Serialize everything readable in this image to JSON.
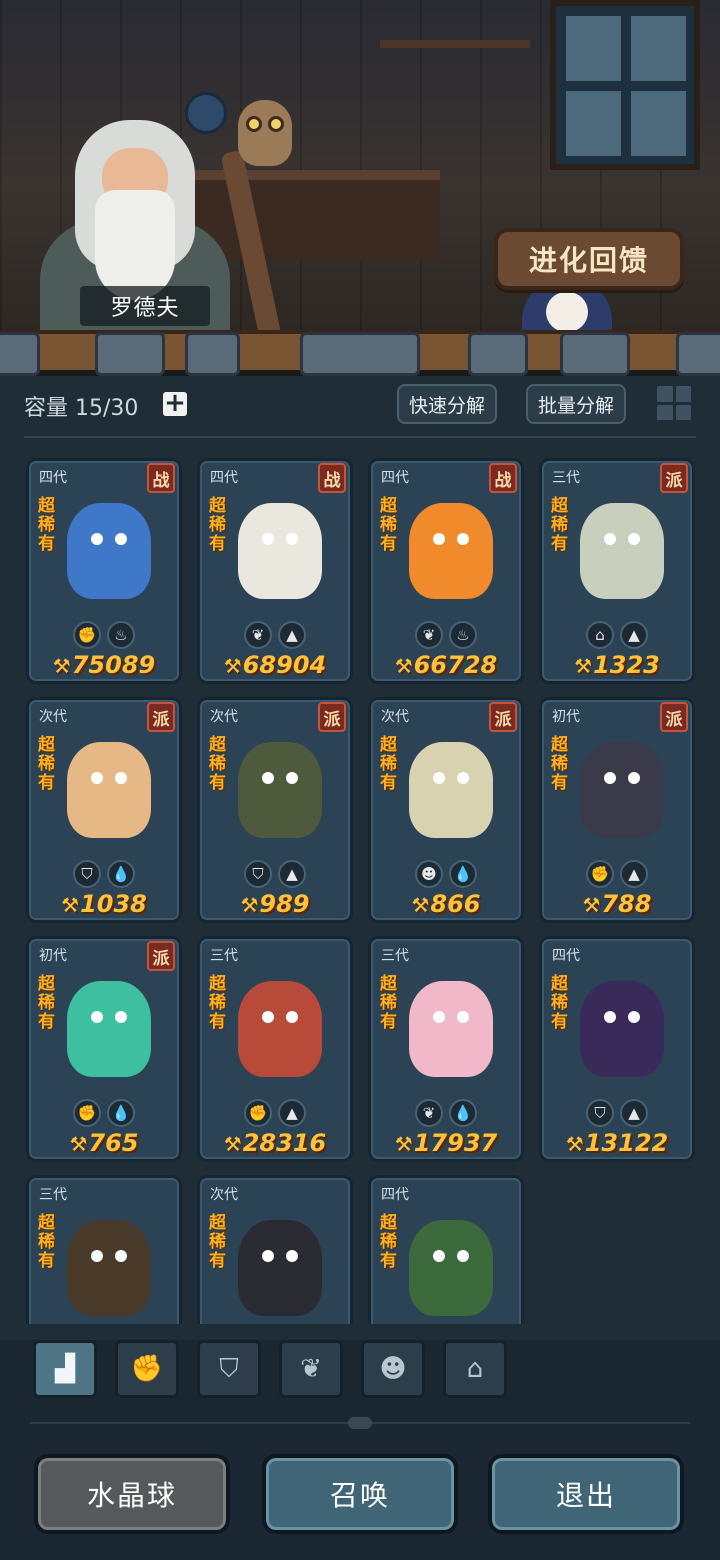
{
  "scene": {
    "npc_name": "罗德夫",
    "evolve_feedback_label": "进化回馈"
  },
  "toolbar": {
    "capacity_label": "容量 15/30",
    "capacity_used": 15,
    "capacity_max": 30,
    "add_capacity_glyph": "+",
    "quick_decompose_label": "快速分解",
    "batch_decompose_label": "批量分解",
    "grid_view_icon": "grid-icon"
  },
  "cards": [
    {
      "generation": "四代",
      "faction": "战",
      "rarity": "超稀有",
      "skills": [
        "fist-icon",
        "fire-icon"
      ],
      "power": "75089",
      "color": "#3f78c8"
    },
    {
      "generation": "四代",
      "faction": "战",
      "rarity": "超稀有",
      "skills": [
        "sprout-icon",
        "earth-icon"
      ],
      "power": "68904",
      "color": "#e9e7de"
    },
    {
      "generation": "四代",
      "faction": "战",
      "rarity": "超稀有",
      "skills": [
        "sprout-icon",
        "fire-icon"
      ],
      "power": "66728",
      "color": "#f08a2a"
    },
    {
      "generation": "三代",
      "faction": "派",
      "rarity": "超稀有",
      "skills": [
        "tower-icon",
        "earth-icon"
      ],
      "power": "1323",
      "color": "#c8cfbd"
    },
    {
      "generation": "次代",
      "faction": "派",
      "rarity": "超稀有",
      "skills": [
        "shield-icon",
        "water-icon"
      ],
      "power": "1038",
      "color": "#e6b886"
    },
    {
      "generation": "次代",
      "faction": "派",
      "rarity": "超稀有",
      "skills": [
        "shield-icon",
        "earth-icon"
      ],
      "power": "989",
      "color": "#4e5a3c"
    },
    {
      "generation": "次代",
      "faction": "派",
      "rarity": "超稀有",
      "skills": [
        "alien-icon",
        "water-icon"
      ],
      "power": "866",
      "color": "#d9d2b0"
    },
    {
      "generation": "初代",
      "faction": "派",
      "rarity": "超稀有",
      "skills": [
        "fist-icon",
        "earth-icon"
      ],
      "power": "788",
      "color": "#3a3a4a"
    },
    {
      "generation": "初代",
      "faction": "派",
      "rarity": "超稀有",
      "skills": [
        "fist-icon",
        "water-icon"
      ],
      "power": "765",
      "color": "#3dbfa0"
    },
    {
      "generation": "三代",
      "faction": "",
      "rarity": "超稀有",
      "skills": [
        "fist-icon",
        "earth-icon"
      ],
      "power": "28316",
      "color": "#b84a3a"
    },
    {
      "generation": "三代",
      "faction": "",
      "rarity": "超稀有",
      "skills": [
        "sprout-icon",
        "water-icon"
      ],
      "power": "17937",
      "color": "#f0b8c8"
    },
    {
      "generation": "四代",
      "faction": "",
      "rarity": "超稀有",
      "skills": [
        "shield-icon",
        "earth-icon"
      ],
      "power": "13122",
      "color": "#3a2a5a"
    },
    {
      "generation": "三代",
      "faction": "",
      "rarity": "超稀有",
      "skills": [],
      "power": "",
      "color": "#4a3a2a"
    },
    {
      "generation": "次代",
      "faction": "",
      "rarity": "超稀有",
      "skills": [],
      "power": "",
      "color": "#2a2a32"
    },
    {
      "generation": "四代",
      "faction": "",
      "rarity": "超稀有",
      "skills": [],
      "power": "",
      "color": "#3c6a3c"
    }
  ],
  "filters": [
    {
      "name": "all-icon",
      "glyph": "▟",
      "active": true
    },
    {
      "name": "fist-icon",
      "glyph": "✊",
      "active": false
    },
    {
      "name": "shield-icon",
      "glyph": "⛉",
      "active": false
    },
    {
      "name": "sprout-icon",
      "glyph": "❦",
      "active": false
    },
    {
      "name": "alien-icon",
      "glyph": "☻",
      "active": false
    },
    {
      "name": "tower-icon",
      "glyph": "⌂",
      "active": false
    }
  ],
  "buttons": {
    "crystal_ball": "水晶球",
    "summon": "召唤",
    "exit": "退出"
  },
  "colors": {
    "power_text": "#ffc23a",
    "rarity_text": "#ffb020",
    "faction_badge": "#7a2a20",
    "card_bg": "#2b4354"
  }
}
